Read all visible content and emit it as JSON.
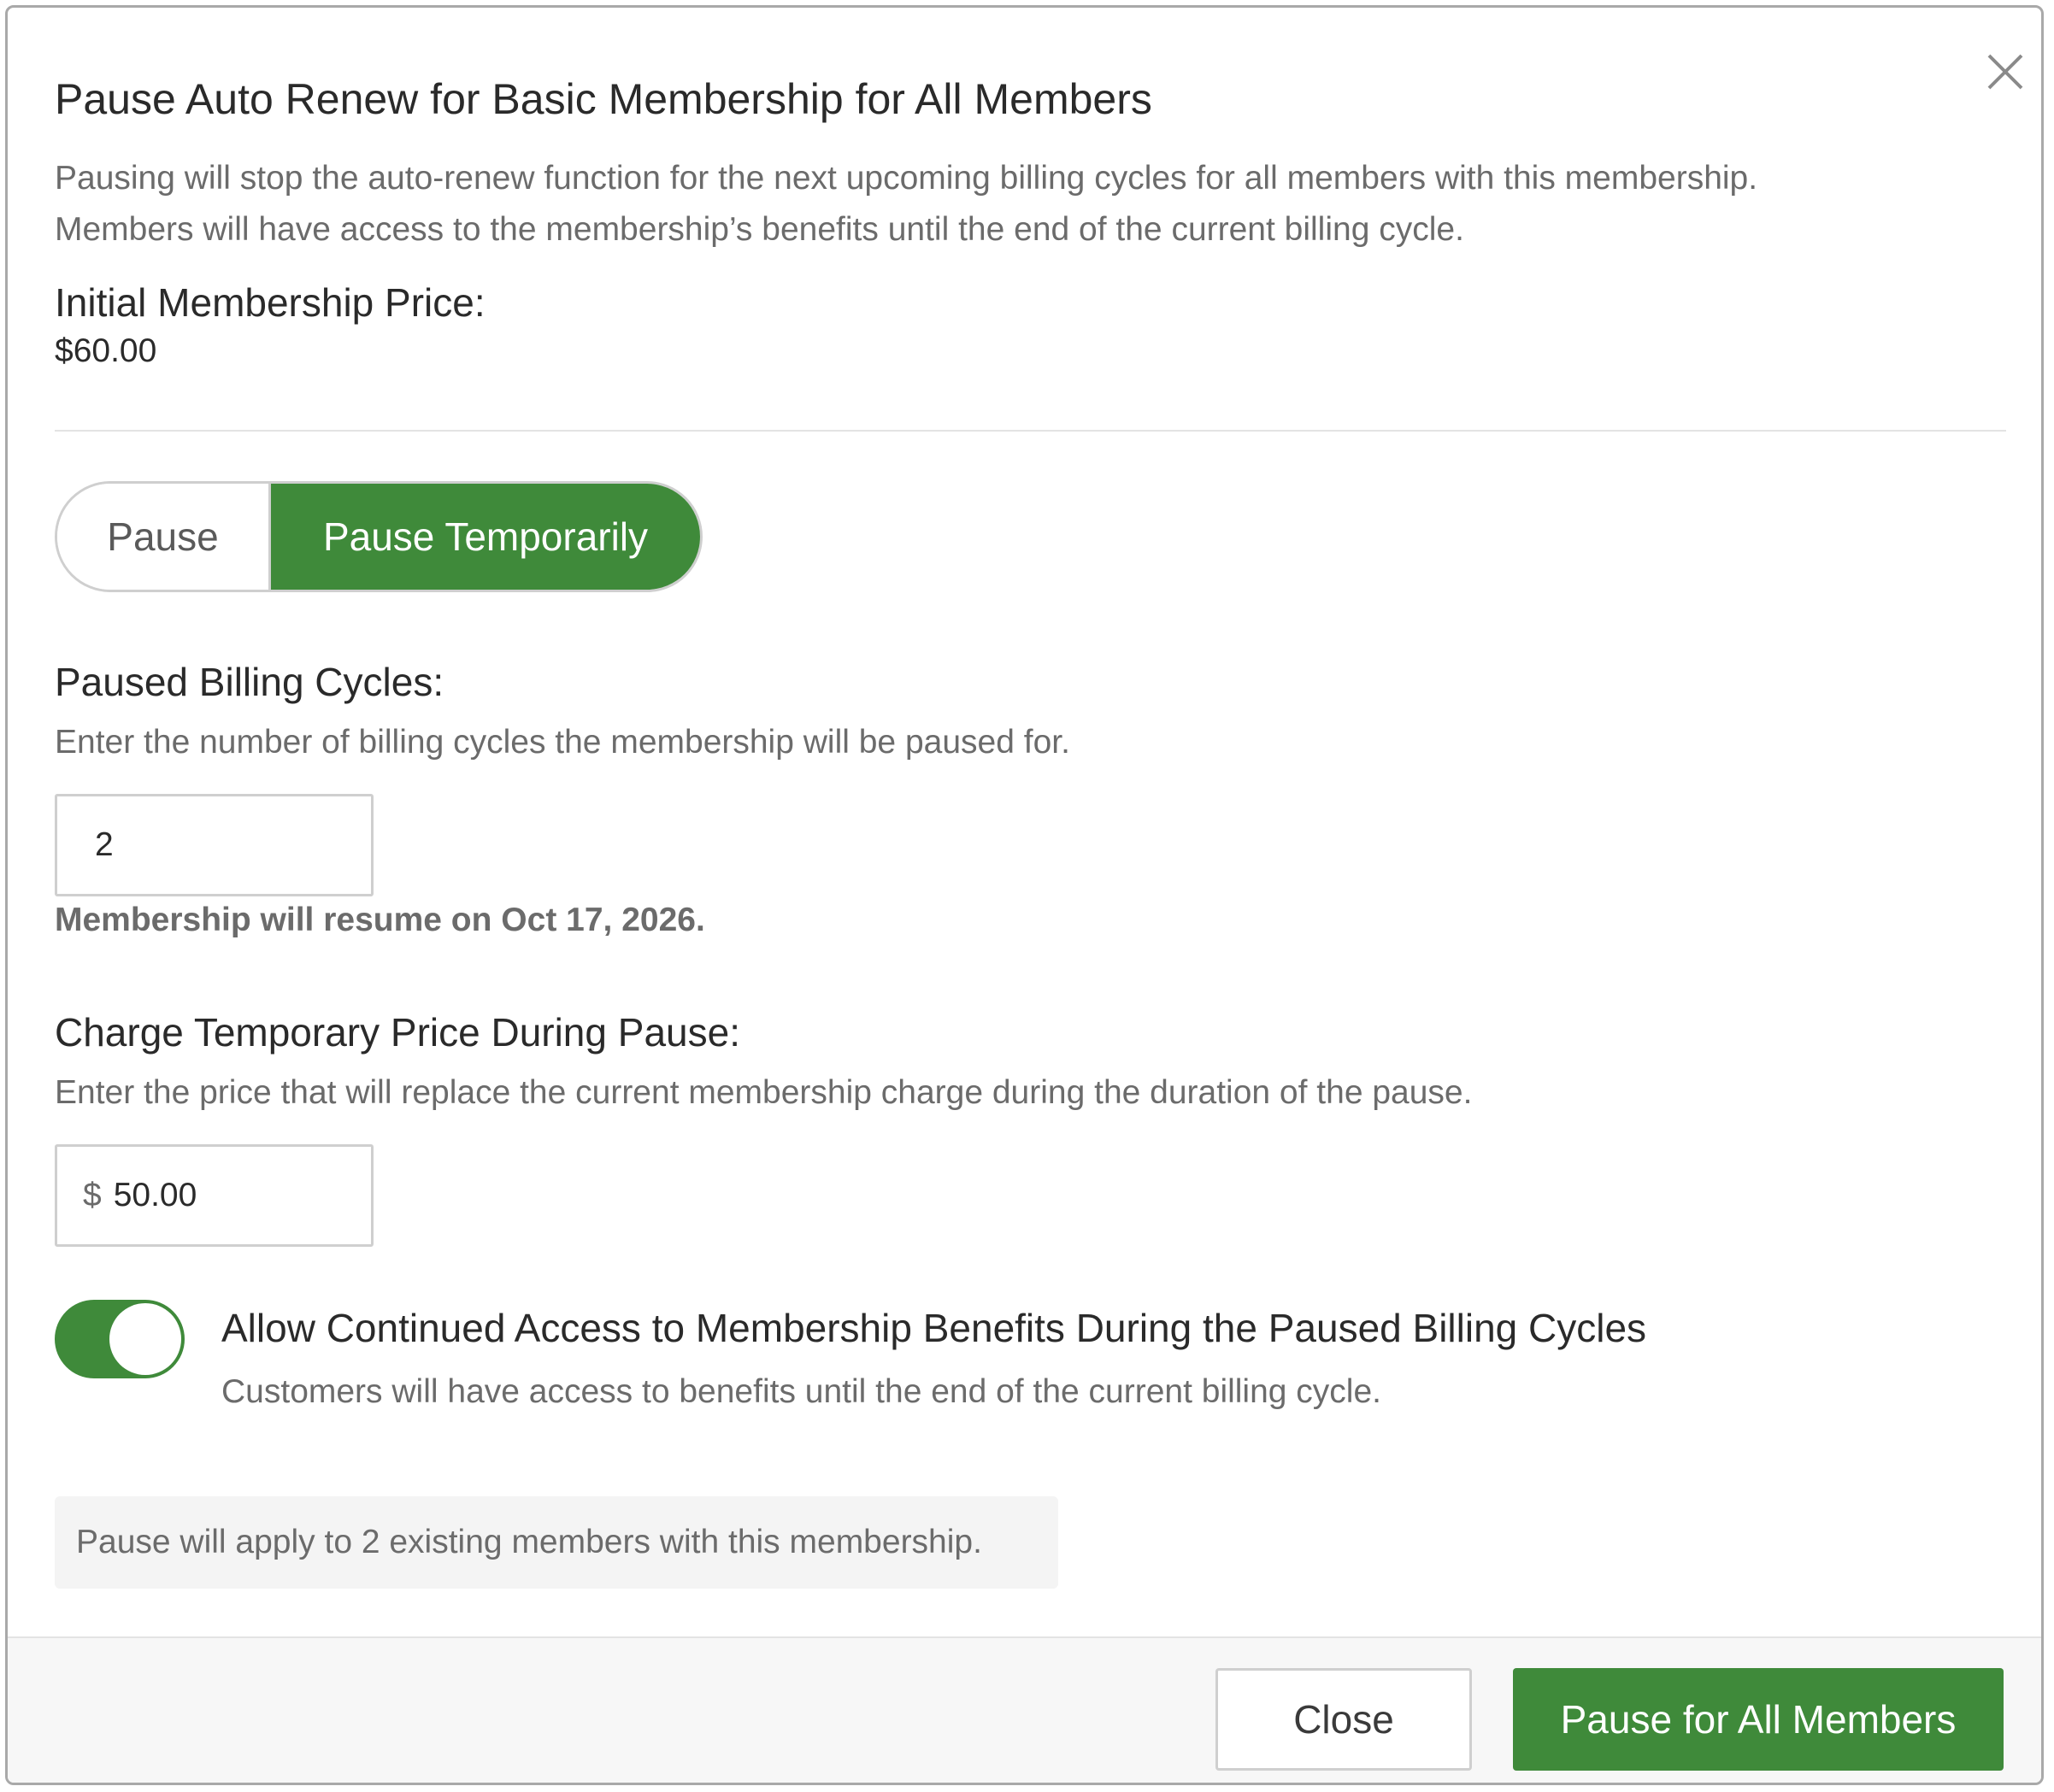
{
  "dialog": {
    "title": "Pause Auto Renew for Basic Membership for All Members",
    "description_line1": "Pausing will stop the auto-renew function for the next upcoming billing cycles for all members with this membership.",
    "description_line2": "Members will have access to the membership’s benefits until the end of the current billing cycle.",
    "close_icon": "close-icon"
  },
  "initial_price": {
    "label": "Initial Membership Price:",
    "value": "$60.00"
  },
  "mode_toggle": {
    "options": [
      "Pause",
      "Pause Temporarily"
    ],
    "selected": "Pause Temporarily"
  },
  "paused_cycles": {
    "label": "Paused Billing Cycles:",
    "help": "Enter the number of billing cycles the membership will be paused for.",
    "value": "2",
    "resume_note": "Membership will resume on Oct 17, 2026."
  },
  "temp_price": {
    "label": "Charge Temporary Price During Pause:",
    "help": "Enter the price that will replace the current membership charge during the duration of the pause.",
    "currency": "$",
    "value": "50.00"
  },
  "continued_access": {
    "enabled": true,
    "label": "Allow Continued Access to Membership Benefits During the Paused Billing Cycles",
    "help": "Customers will have access to benefits until the end of the current billing cycle."
  },
  "info": {
    "text": "Pause will apply to 2 existing members with this membership."
  },
  "footer": {
    "close_label": "Close",
    "primary_label": "Pause for All Members"
  },
  "colors": {
    "accent": "#3f8a3a",
    "border": "#cfcfcf",
    "muted_text": "#6b6b6b"
  }
}
